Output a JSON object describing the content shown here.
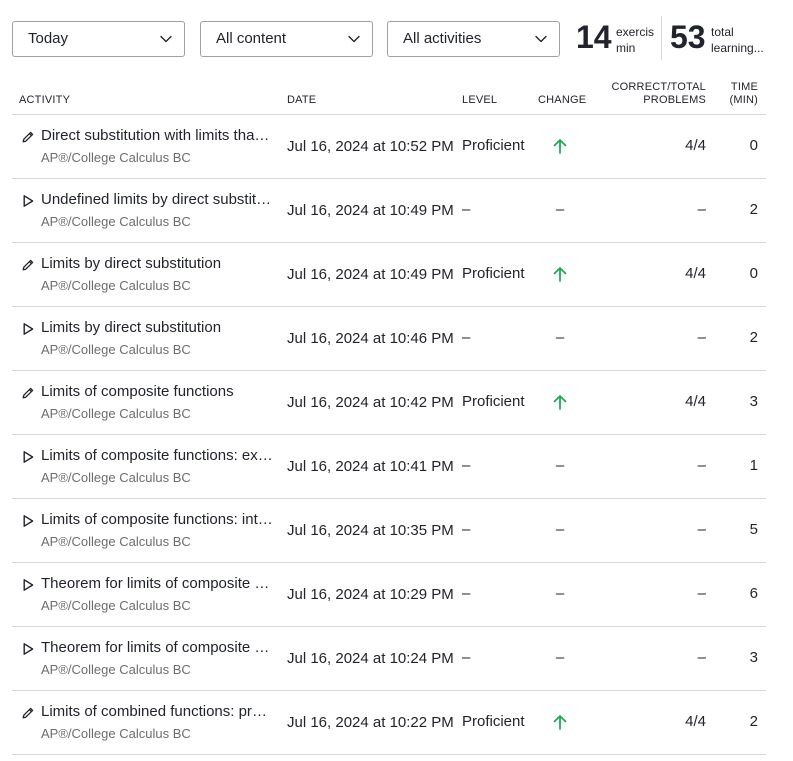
{
  "filters": {
    "period": "Today",
    "content": "All content",
    "activities": "All activities"
  },
  "stats": {
    "exercise": {
      "value": "14",
      "label_line1": "exercis",
      "label_line2": "min"
    },
    "learning": {
      "value": "53",
      "label_line1": "total",
      "label_line2": "learning..."
    }
  },
  "table": {
    "headers": {
      "activity": "ACTIVITY",
      "date": "DATE",
      "level": "LEVEL",
      "change": "CHANGE",
      "correct_line1": "CORRECT/TOTAL",
      "correct_line2": "PROBLEMS",
      "time_line1": "TIME",
      "time_line2": "(MIN)"
    },
    "rows": [
      {
        "type": "exercise",
        "icon": "pencil-icon",
        "title": "Direct substitution with limits that ...",
        "course": "AP®/College Calculus BC",
        "date": "Jul 16, 2024 at 10:52 PM",
        "level": "Proficient",
        "change": "up",
        "correct": "4/4",
        "time": "0"
      },
      {
        "type": "video",
        "icon": "play-icon",
        "title": "Undefined limits by direct substitu...",
        "course": "AP®/College Calculus BC",
        "date": "Jul 16, 2024 at 10:49 PM",
        "level": "–",
        "change": "–",
        "correct": "–",
        "time": "2"
      },
      {
        "type": "exercise",
        "icon": "pencil-icon",
        "title": "Limits by direct substitution",
        "course": "AP®/College Calculus BC",
        "date": "Jul 16, 2024 at 10:49 PM",
        "level": "Proficient",
        "change": "up",
        "correct": "4/4",
        "time": "0"
      },
      {
        "type": "video",
        "icon": "play-icon",
        "title": "Limits by direct substitution",
        "course": "AP®/College Calculus BC",
        "date": "Jul 16, 2024 at 10:46 PM",
        "level": "–",
        "change": "–",
        "correct": "–",
        "time": "2"
      },
      {
        "type": "exercise",
        "icon": "pencil-icon",
        "title": "Limits of composite functions",
        "course": "AP®/College Calculus BC",
        "date": "Jul 16, 2024 at 10:42 PM",
        "level": "Proficient",
        "change": "up",
        "correct": "4/4",
        "time": "3"
      },
      {
        "type": "video",
        "icon": "play-icon",
        "title": "Limits of composite functions: ext...",
        "course": "AP®/College Calculus BC",
        "date": "Jul 16, 2024 at 10:41 PM",
        "level": "–",
        "change": "–",
        "correct": "–",
        "time": "1"
      },
      {
        "type": "video",
        "icon": "play-icon",
        "title": "Limits of composite functions: inte...",
        "course": "AP®/College Calculus BC",
        "date": "Jul 16, 2024 at 10:35 PM",
        "level": "–",
        "change": "–",
        "correct": "–",
        "time": "5"
      },
      {
        "type": "video",
        "icon": "play-icon",
        "title": "Theorem for limits of composite fu...",
        "course": "AP®/College Calculus BC",
        "date": "Jul 16, 2024 at 10:29 PM",
        "level": "–",
        "change": "–",
        "correct": "–",
        "time": "6"
      },
      {
        "type": "video",
        "icon": "play-icon",
        "title": "Theorem for limits of composite fu...",
        "course": "AP®/College Calculus BC",
        "date": "Jul 16, 2024 at 10:24 PM",
        "level": "–",
        "change": "–",
        "correct": "–",
        "time": "3"
      },
      {
        "type": "exercise",
        "icon": "pencil-icon",
        "title": "Limits of combined functions: prod...",
        "course": "AP®/College Calculus BC",
        "date": "Jul 16, 2024 at 10:22 PM",
        "level": "Proficient",
        "change": "up",
        "correct": "4/4",
        "time": "2"
      }
    ]
  },
  "colors": {
    "text": "#21242c",
    "subtext": "#6b6d72",
    "border": "#d6d8da",
    "up_arrow": "#1fab54"
  }
}
